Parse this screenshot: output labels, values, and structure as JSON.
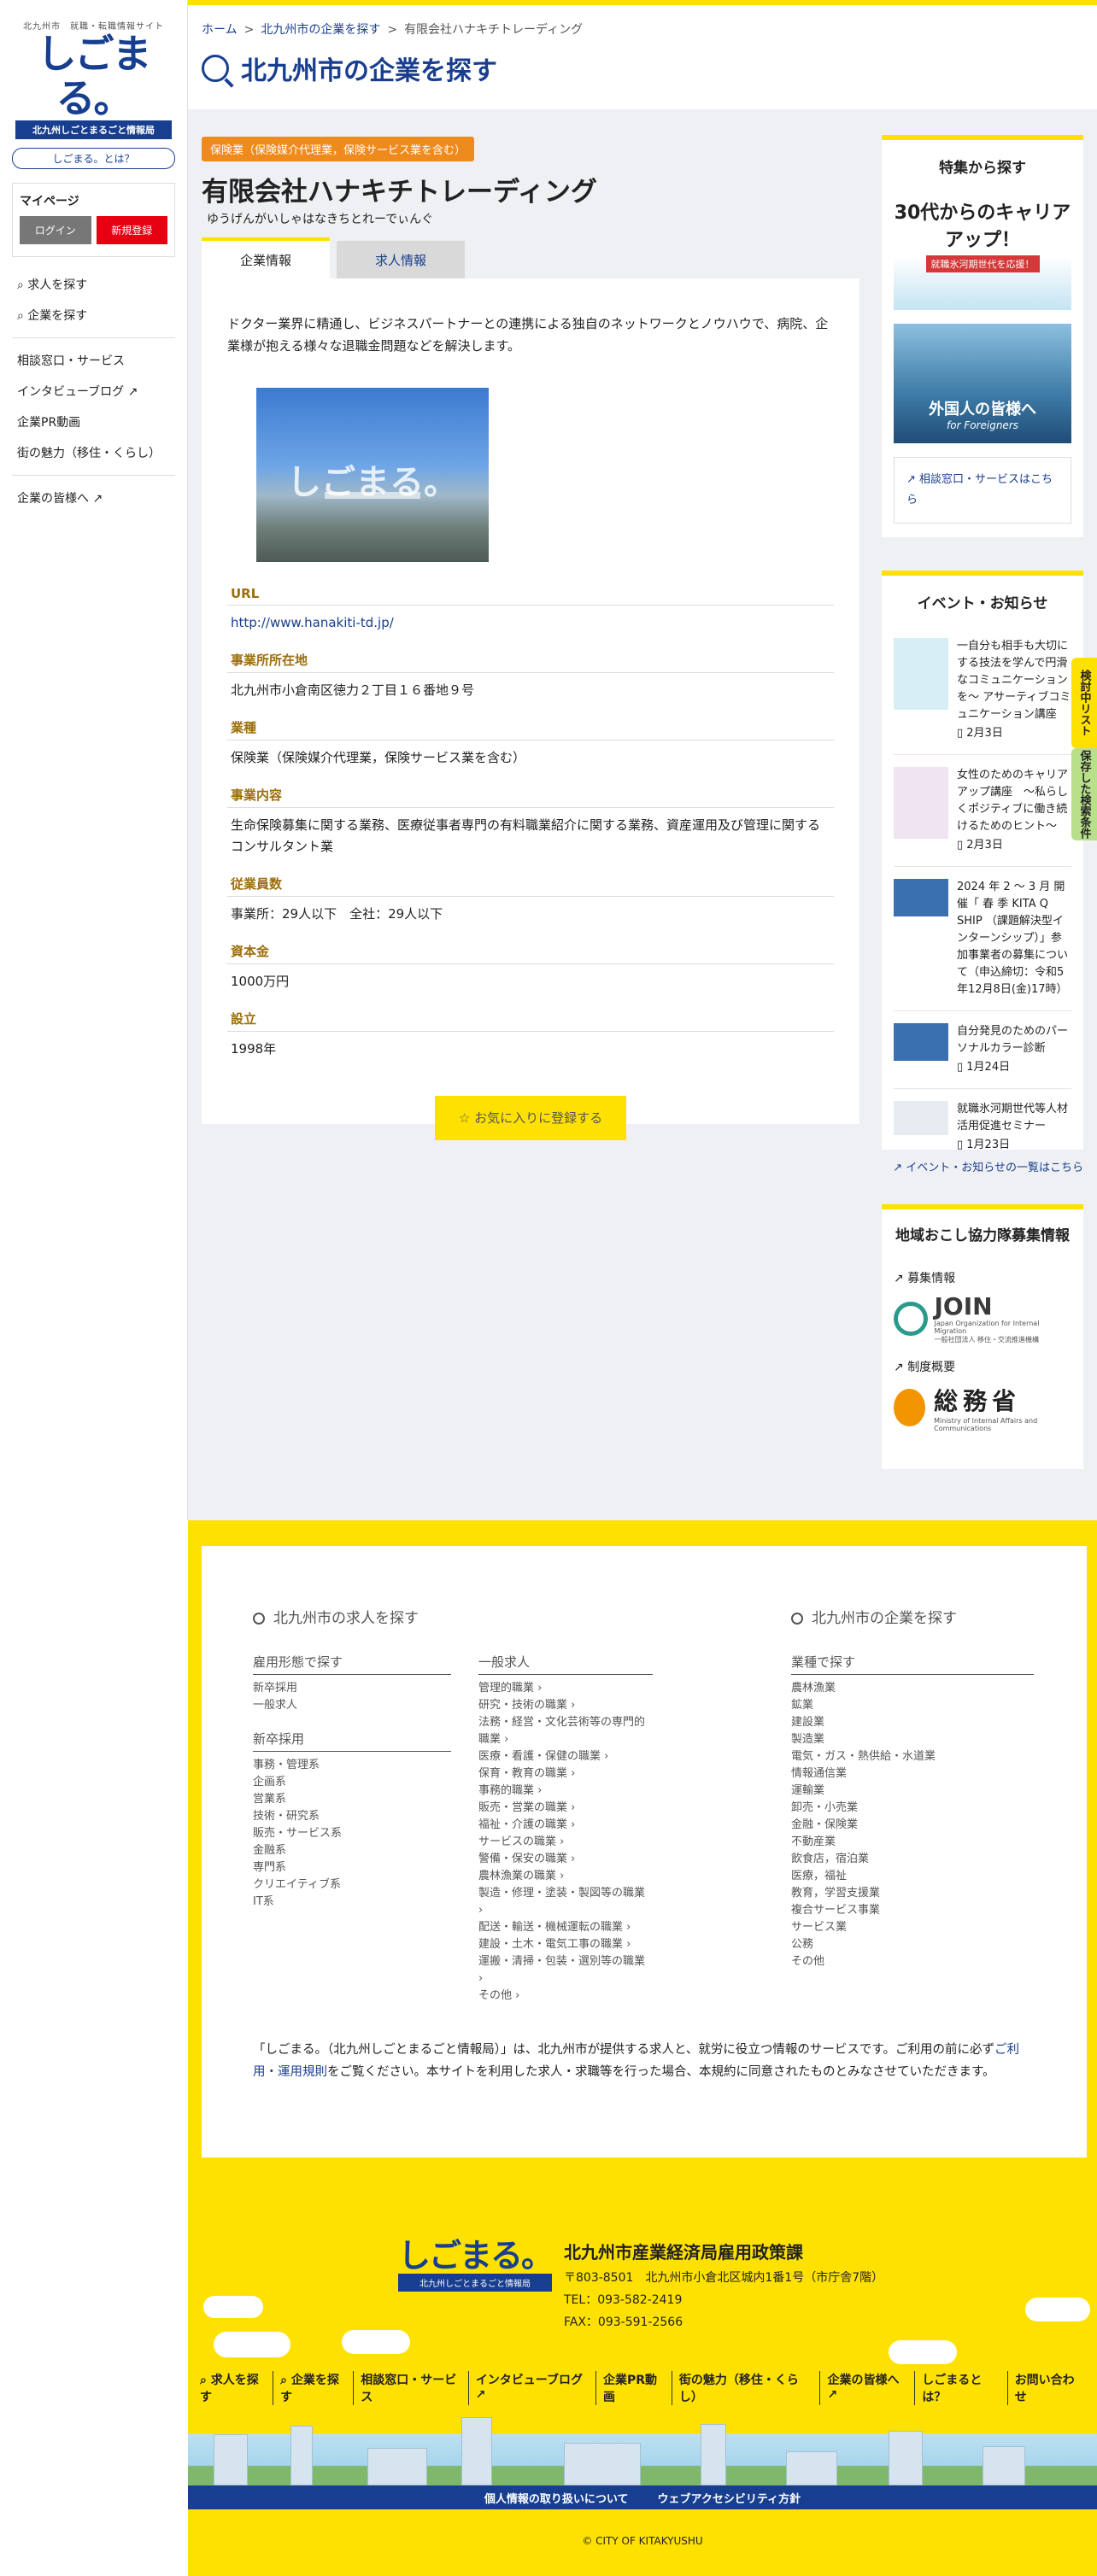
{
  "sidebar": {
    "logo_small": "北九州市　就職・転職情報サイト",
    "logo_main": "しごまる。",
    "logo_band": "北九州しごとまるごと情報局",
    "about_label": "しごまる。とは？",
    "mypage_title": "マイページ",
    "login_label": "ログイン",
    "register_label": "新規登録",
    "nav_primary": [
      "求人を探す",
      "企業を探す"
    ],
    "nav_secondary": [
      "相談窓口・サービス",
      "インタビューブログ",
      "企業PR動画",
      "街の魅力（移住・くらし）"
    ],
    "nav_tertiary": [
      "企業の皆様へ"
    ]
  },
  "header": {
    "breadcrumb": [
      "ホーム",
      "北九州市の企業を探す",
      "有限会社ハナキチトレーディング"
    ],
    "page_title": "北九州市の企業を探す"
  },
  "company": {
    "industry_badge": "保険業（保険媒介代理業，保険サービス業を含む）",
    "name": "有限会社ハナキチトレーディング",
    "kana": "ゆうげんがいしゃはなきちとれーでぃんぐ",
    "tab_company": "企業情報",
    "tab_jobs": "求人情報",
    "intro": "ドクター業界に精通し、ビジネスパートナーとの連携による独自のネットワークとノウハウで、病院、企業様が抱える様々な退職金問題などを解決します。",
    "photo_watermark": "しごまる。",
    "info": [
      {
        "label": "URL",
        "value": "http://www.hanakiti-td.jp/"
      },
      {
        "label": "事業所所在地",
        "value": "北九州市小倉南区徳力２丁目１６番地９号"
      },
      {
        "label": "業種",
        "value": "保険業（保険媒介代理業，保険サービス業を含む）"
      },
      {
        "label": "事業内容",
        "value": "生命保険募集に関する業務、医療従事者専門の有料職業紹介に関する業務、資産運用及び管理に関するコンサルタント業"
      },
      {
        "label": "従業員数",
        "value": "事業所：29人以下　全社：29人以下"
      },
      {
        "label": "資本金",
        "value": "1000万円"
      },
      {
        "label": "設立",
        "value": "1998年"
      }
    ],
    "favorite_label": "お気に入りに登録する"
  },
  "right": {
    "feature_title": "特集から探す",
    "banner_career_big": "30代からのキャリアアップ！",
    "banner_career_sub": "就職氷河期世代を応援！",
    "banner_foreign_big": "外国人の皆様へ",
    "banner_foreign_sub": "for Foreigners",
    "consult_link": "相談窓口・サービスはこちら",
    "events_title": "イベント・お知らせ",
    "events": [
      {
        "title": "一自分も相手も大切にする技法を学んで円滑なコミュニケーションを～ アサーティブコミュニケーション講座",
        "date": "2月3日"
      },
      {
        "title": "女性のためのキャリアアップ講座　～私らしくポジティブに働き続けるためのヒント～",
        "date": "2月3日"
      },
      {
        "title": "2024 年 2 ～ 3 月 開 催「 春 季 KITA Q SHIP （課題解決型インターンシップ）」参加事業者の募集について（申込締切：令和5年12月8日(金)17時）",
        "date": ""
      },
      {
        "title": "自分発見のためのパーソナルカラー診断",
        "date": "1月24日"
      },
      {
        "title": "就職氷河期世代等人材活用促進セミナー",
        "date": "1月23日"
      }
    ],
    "events_more": "イベント・お知らせの一覧はこちら",
    "region_title": "地域おこし協力隊募集情報",
    "recruit_label": "募集情報",
    "join_logo": "JOIN",
    "join_sub": "Japan Organization for Internal Migration",
    "join_sub2": "一般社団法人 移住・交流推進機構",
    "system_label": "制度概要",
    "soumu_logo": "総務省",
    "soumu_sub": "Ministry of Internal Affairs and Communications"
  },
  "float_tabs": [
    "検討中リスト",
    "保存した検索条件"
  ],
  "footer": {
    "jobs_heading": "北九州市の求人を探す",
    "companies_heading": "北九州市の企業を探す",
    "employment_heading": "雇用形態で探す",
    "employment_items": [
      "新卒採用",
      "一般求人"
    ],
    "newgrad_heading": "新卒採用",
    "newgrad_items": [
      "事務・管理系",
      "企画系",
      "営業系",
      "技術・研究系",
      "販売・サービス系",
      "金融系",
      "専門系",
      "クリエイティブ系",
      "IT系"
    ],
    "general_heading": "一般求人",
    "general_items": [
      "管理的職業",
      "研究・技術の職業",
      "法務・経営・文化芸術等の専門的職業",
      "医療・看護・保健の職業",
      "保育・教育の職業",
      "事務的職業",
      "販売・営業の職業",
      "福祉・介護の職業",
      "サービスの職業",
      "警備・保安の職業",
      "農林漁業の職業",
      "製造・修理・塗装・製図等の職業",
      "配送・輸送・機械運転の職業",
      "建設・土木・電気工事の職業",
      "運搬・清掃・包装・選別等の職業",
      "その他"
    ],
    "industry_heading": "業種で探す",
    "industry_items": [
      "農林漁業",
      "鉱業",
      "建設業",
      "製造業",
      "電気・ガス・熱供給・水道業",
      "情報通信業",
      "運輸業",
      "卸売・小売業",
      "金融・保険業",
      "不動産業",
      "飲食店，宿泊業",
      "医療，福祉",
      "教育，学習支援業",
      "複合サービス事業",
      "サービス業",
      "公務",
      "その他"
    ],
    "note_before": "「しごまる。（北九州しごとまるごと情報局）」は、北九州市が提供する求人と、就労に役立つ情報のサービスです。ご利用の前に必ず",
    "note_link": "ご利用・運用規則",
    "note_after": "をご覧ください。本サイトを利用した求人・求職等を行った場合、本規約に同意されたものとみなさせていただきます。",
    "org_name": "北九州市産業経済局雇用政策課",
    "address": "〒803-8501　北九州市小倉北区城内1番1号（市庁舎7階）",
    "tel": "TEL：093-582-2419",
    "fax": "FAX：093-591-2566",
    "nav": [
      "求人を探す",
      "企業を探す",
      "相談窓口・サービス",
      "インタビューブログ",
      "企業PR動画",
      "街の魅力（移住・くらし）",
      "企業の皆様へ",
      "しごまるとは？",
      "お問い合わせ"
    ],
    "privacy": "個人情報の取り扱いについて",
    "accessibility": "ウェブアクセシビリティ方針",
    "copyright": "© CITY OF KITAKYUSHU"
  },
  "colors": {
    "brand_blue": "#183e8f",
    "accent_yellow": "#ffe100",
    "badge_orange": "#ef8a1c",
    "label_brown": "#9c6e0c",
    "register_red": "#e60012"
  }
}
